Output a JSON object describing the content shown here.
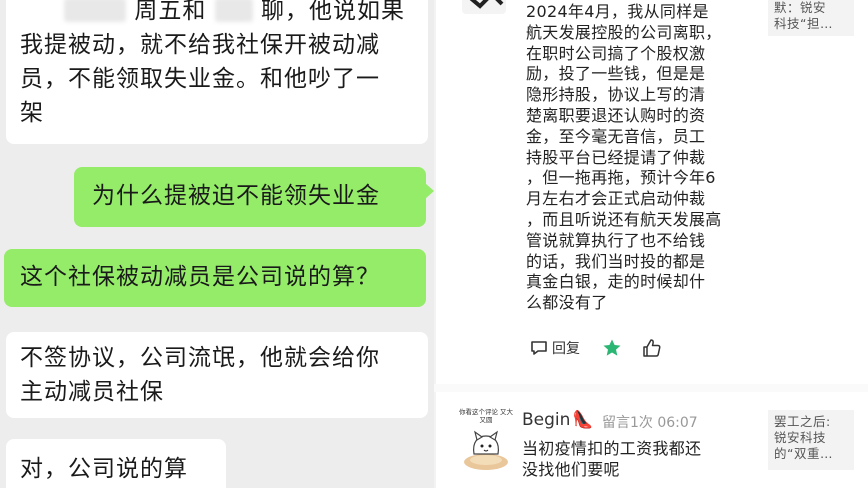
{
  "chat": {
    "messages": [
      {
        "side": "in",
        "lines": [
          "周五和",
          "聊，他说如果",
          "我提被动，就不给我社保开被动减",
          "员，不能领取失业金。和他吵了一",
          "架"
        ]
      },
      {
        "side": "out",
        "lines": [
          "为什么提被迫不能领失业金"
        ]
      },
      {
        "side": "out",
        "lines": [
          "这个社保被动减员是公司说的算？"
        ]
      },
      {
        "side": "in",
        "lines": [
          "不签协议，公司流氓，他就会给你",
          "主动减员社保"
        ]
      },
      {
        "side": "in",
        "lines": [
          "对，公司说的算"
        ]
      }
    ],
    "colors": {
      "bg": "#ededed",
      "in_bubble": "#ffffff",
      "out_bubble": "#95ec69"
    }
  },
  "thread": {
    "main_comment": {
      "lines": [
        "2024年4月，我从同样是",
        "航天发展控股的公司离职，",
        "在职时公司搞了个股权激",
        "励，投了一些钱，但是是",
        "隐形持股，协议上写的清",
        "楚离职要退还认购时的资",
        "金，至今毫无音信，员工",
        "持股平台已经提请了仲裁",
        "，但一拖再拖，预计今年6",
        "月左右才会正式启动仲裁",
        "，而且听说还有航天发展高",
        "管说就算执行了也不给钱",
        "的话，我们当时投的都是",
        "真金白银，走的时候却什",
        "么都没有了"
      ],
      "reply_label": "回复",
      "star_icon": "star-icon",
      "like_icon": "thumbs-up-icon"
    },
    "side_cards": [
      {
        "lines": [
          "默：锐安",
          "科技“担…"
        ]
      },
      {
        "lines": [
          "罢工之后:",
          "锐安科技",
          "的“双重…"
        ]
      }
    ],
    "reply": {
      "sticker_caption": "你看这个评论 又大又圆",
      "name": "Begin",
      "name_emoji": "👠",
      "meta": "留言1次 06:07",
      "lines": [
        "当初疫情扣的工资我都还",
        "没找他们要呢"
      ]
    },
    "colors": {
      "star": "#2bb673",
      "text": "#222222",
      "meta": "#999999"
    }
  }
}
